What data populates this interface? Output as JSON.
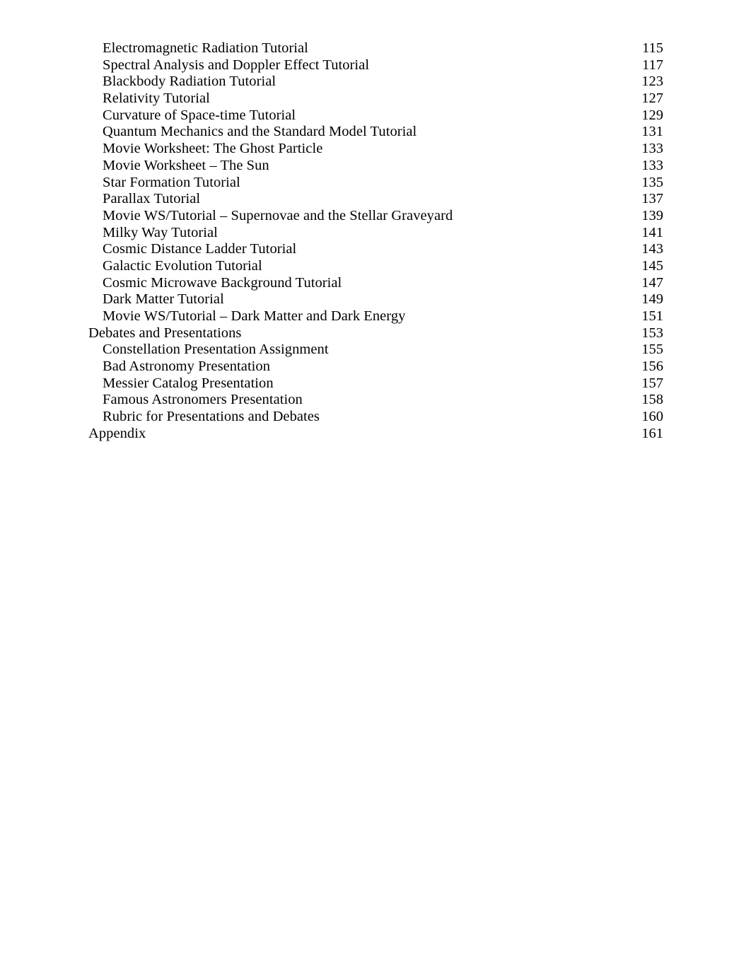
{
  "document": {
    "type": "table-of-contents",
    "background_color": "#ffffff",
    "text_color": "#000000"
  },
  "toc": {
    "entries": [
      {
        "title": "Electromagnetic Radiation Tutorial",
        "page": "115",
        "level": 2
      },
      {
        "title": "Spectral Analysis and Doppler Effect Tutorial",
        "page": "117",
        "level": 2
      },
      {
        "title": "Blackbody Radiation Tutorial",
        "page": "123",
        "level": 2
      },
      {
        "title": "Relativity Tutorial",
        "page": "127",
        "level": 2
      },
      {
        "title": "Curvature of Space-time Tutorial",
        "page": "129",
        "level": 2
      },
      {
        "title": "Quantum Mechanics and the Standard Model Tutorial",
        "page": "131",
        "level": 2
      },
      {
        "title": "Movie Worksheet: The Ghost Particle",
        "page": "133",
        "level": 2
      },
      {
        "title": "Movie Worksheet – The Sun",
        "page": "133",
        "level": 2
      },
      {
        "title": "Star Formation Tutorial",
        "page": "135",
        "level": 2
      },
      {
        "title": "Parallax Tutorial",
        "page": "137",
        "level": 2
      },
      {
        "title": "Movie WS/Tutorial – Supernovae and the Stellar Graveyard",
        "page": "139",
        "level": 2
      },
      {
        "title": "Milky Way Tutorial",
        "page": "141",
        "level": 2
      },
      {
        "title": "Cosmic Distance Ladder Tutorial",
        "page": "143",
        "level": 2
      },
      {
        "title": "Galactic Evolution Tutorial",
        "page": "145",
        "level": 2
      },
      {
        "title": "Cosmic Microwave Background Tutorial",
        "page": "147",
        "level": 2
      },
      {
        "title": "Dark Matter Tutorial",
        "page": "149",
        "level": 2
      },
      {
        "title": "Movie WS/Tutorial – Dark Matter and Dark Energy",
        "page": "151",
        "level": 2
      },
      {
        "title": "Debates and Presentations",
        "page": "153",
        "level": 1
      },
      {
        "title": "Constellation Presentation Assignment",
        "page": "155",
        "level": 2
      },
      {
        "title": "Bad Astronomy Presentation",
        "page": "156",
        "level": 2
      },
      {
        "title": "Messier Catalog Presentation",
        "page": "157",
        "level": 2
      },
      {
        "title": "Famous Astronomers Presentation",
        "page": "158",
        "level": 2
      },
      {
        "title": "Rubric for Presentations and Debates",
        "page": "160",
        "level": 2
      },
      {
        "title": "Appendix",
        "page": "161",
        "level": 1
      }
    ]
  }
}
